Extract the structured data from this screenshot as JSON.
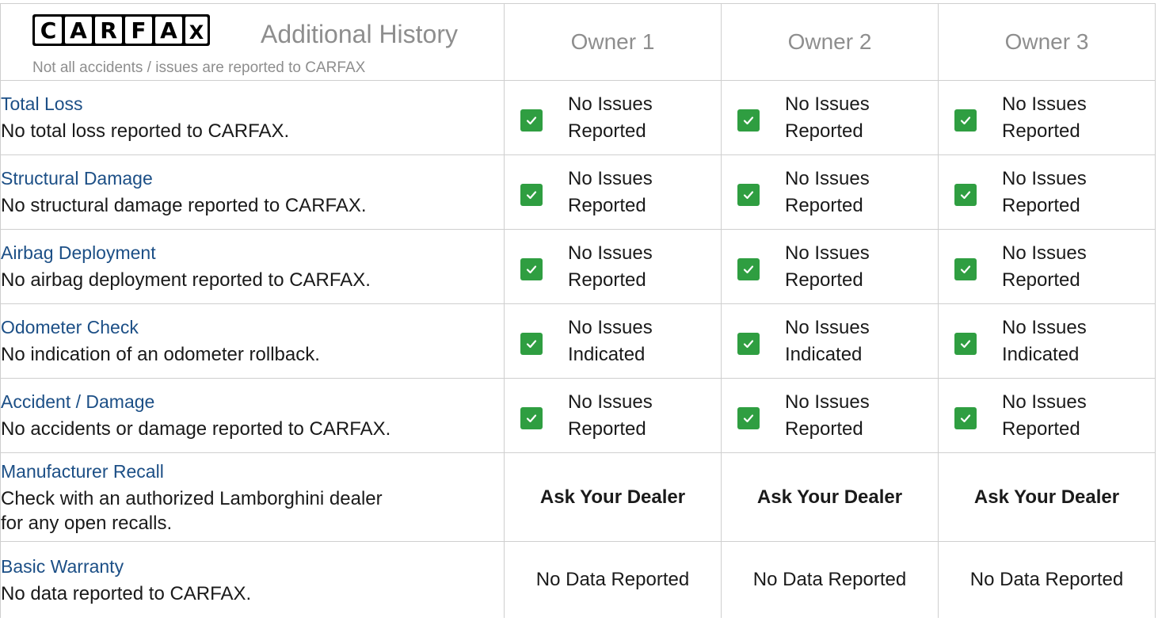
{
  "header": {
    "logo_letters": [
      "C",
      "A",
      "R",
      "F",
      "A",
      "X"
    ],
    "title": "Additional History",
    "note": "Not all accidents / issues are reported to CARFAX",
    "owners": [
      "Owner 1",
      "Owner 2",
      "Owner 3"
    ]
  },
  "rows": [
    {
      "title": "Total Loss",
      "description": "No total loss reported to CARFAX.",
      "status": [
        "No Issues",
        "Reported"
      ]
    },
    {
      "title": "Structural Damage",
      "description": "No structural damage reported to CARFAX.",
      "status": [
        "No Issues",
        "Reported"
      ]
    },
    {
      "title": "Airbag Deployment",
      "description": "No airbag deployment reported to CARFAX.",
      "status": [
        "No Issues",
        "Reported"
      ]
    },
    {
      "title": "Odometer Check",
      "description": "No indication of an odometer rollback.",
      "status": [
        "No Issues",
        "Indicated"
      ]
    },
    {
      "title": "Accident / Damage",
      "description": "No accidents or damage reported to CARFAX.",
      "status": [
        "No Issues",
        "Reported"
      ]
    },
    {
      "title": "Manufacturer Recall",
      "description_lines": [
        "Check with an authorized Lamborghini dealer",
        "for any open recalls."
      ],
      "value": "Ask Your Dealer"
    },
    {
      "title": "Basic Warranty",
      "description": "No data reported to CARFAX.",
      "value": "No Data Reported"
    }
  ],
  "colors": {
    "check_green": "#2f9e41",
    "title_blue": "#1c4f86",
    "muted_gray": "#8e8e8e",
    "border_gray": "#cfcfcf"
  },
  "icons": {
    "check": "checkbox-checked-icon",
    "logo": "carfax-logo"
  }
}
